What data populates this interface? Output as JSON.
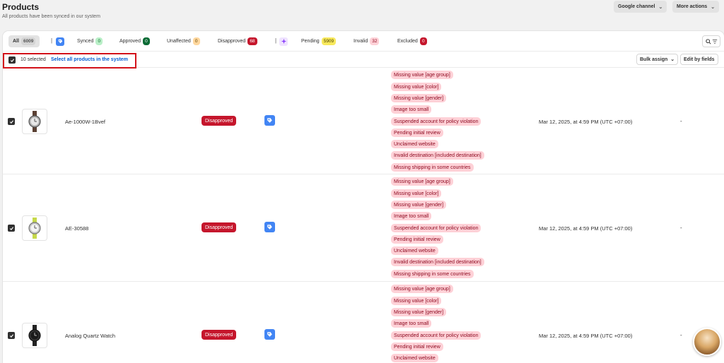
{
  "header": {
    "title": "Products",
    "subtitle": "All products have been synced in our system",
    "google_channel": "Google channel",
    "more_actions": "More actions"
  },
  "tabs": [
    {
      "label": "All",
      "count": "6009"
    },
    {
      "label": "Synced",
      "count": "0"
    },
    {
      "label": "Approved",
      "count": "0"
    },
    {
      "label": "Unaffected",
      "count": "0"
    },
    {
      "label": "Disapproved",
      "count": "68"
    },
    {
      "label": "Pending",
      "count": "5909"
    },
    {
      "label": "Invalid",
      "count": "32"
    },
    {
      "label": "Excluded",
      "count": "0"
    }
  ],
  "selection": {
    "selected_text": "10 selected",
    "select_all_link": "Select all products in the system",
    "bulk_assign": "Bulk assign",
    "edit_by_fields": "Edit by fields"
  },
  "issues": [
    "Missing value [age group]",
    "Missing value [color]",
    "Missing value [gender]",
    "Image too small",
    "Suspended account for policy violation",
    "Pending initial review",
    "Unclaimed website",
    "Invalid destination [included destination]",
    "Missing shipping in some countries"
  ],
  "rows": [
    {
      "name": "Ae-1000W-1Bvef",
      "status": "Disapproved",
      "date": "Mar 12, 2025, at 4:59 PM (UTC +07:00)",
      "extra": "-"
    },
    {
      "name": "AE-30588",
      "status": "Disapproved",
      "date": "Mar 12, 2025, at 4:59 PM (UTC +07:00)",
      "extra": "-"
    },
    {
      "name": "Analog Quartz Watch",
      "status": "Disapproved",
      "date": "Mar 12, 2025, at 4:59 PM (UTC +07:00)",
      "extra": "-"
    }
  ],
  "colors": {
    "accent_link": "#005bd3",
    "critical": "#c5162c",
    "highlight_border": "#d3121a"
  }
}
